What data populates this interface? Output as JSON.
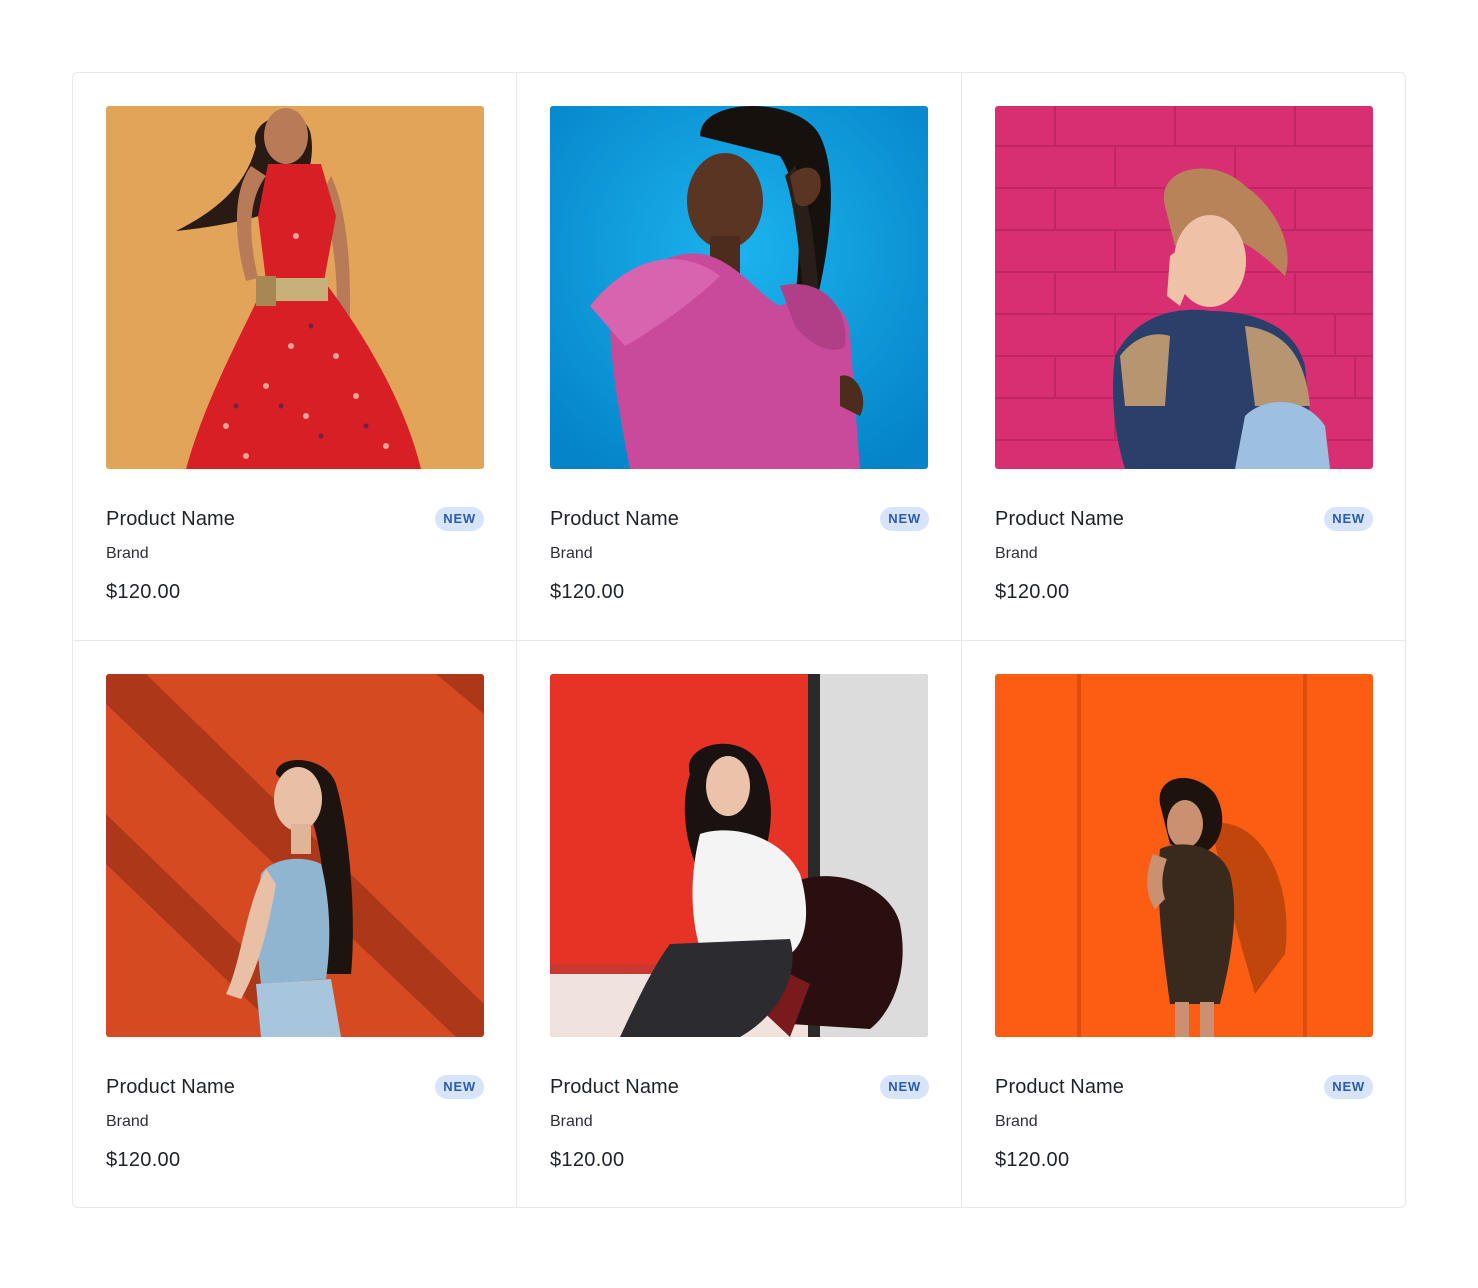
{
  "products": [
    {
      "name": "Product Name",
      "badge": "NEW",
      "brand": "Brand",
      "price": "$120.00",
      "photo": "woman-red-dress-on-mustard-background",
      "bg": "#e5a95c",
      "accent": "#d91f26"
    },
    {
      "name": "Product Name",
      "badge": "NEW",
      "brand": "Brand",
      "price": "$120.00",
      "photo": "woman-pink-blouse-on-blue-background",
      "bg": "#0a9ddb",
      "accent": "#c94a9a"
    },
    {
      "name": "Product Name",
      "badge": "NEW",
      "brand": "Brand",
      "price": "$120.00",
      "photo": "woman-bomber-jacket-on-pink-brick-wall",
      "bg": "#d82f72",
      "accent": "#2b3f6b"
    },
    {
      "name": "Product Name",
      "badge": "NEW",
      "brand": "Brand",
      "price": "$120.00",
      "photo": "woman-blue-top-on-orange-wall",
      "bg": "#d64a22",
      "accent": "#8fb5d1"
    },
    {
      "name": "Product Name",
      "badge": "NEW",
      "brand": "Brand",
      "price": "$120.00",
      "photo": "woman-white-shirt-on-red-backdrop",
      "bg": "#e63326",
      "accent": "#f1f1f1"
    },
    {
      "name": "Product Name",
      "badge": "NEW",
      "brand": "Brand",
      "price": "$120.00",
      "photo": "woman-dark-romper-on-orange-wall",
      "bg": "#fb5e12",
      "accent": "#3a2a1e"
    }
  ]
}
